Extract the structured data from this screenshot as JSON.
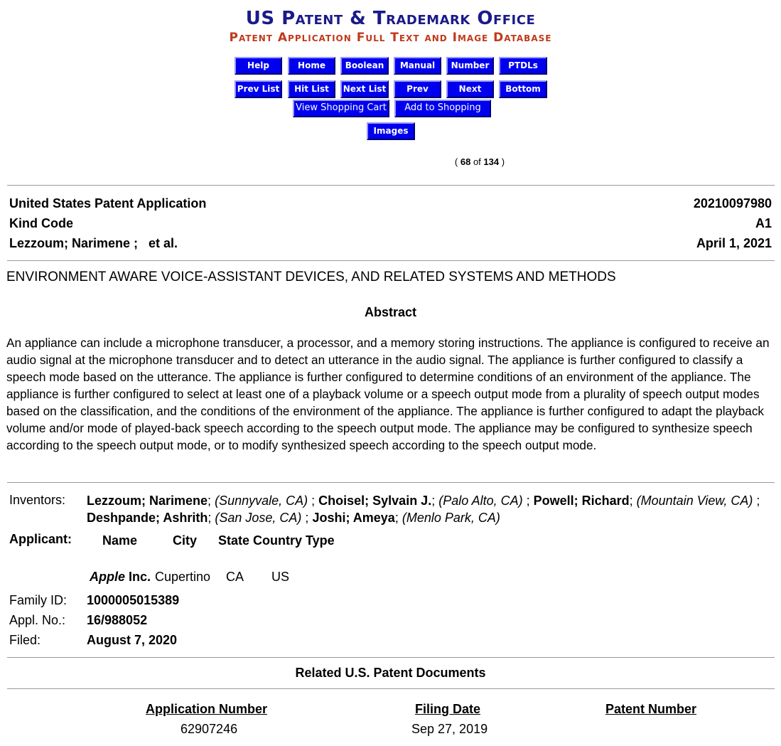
{
  "header": {
    "title": "US Patent & Trademark Office",
    "subtitle": "Patent Application Full Text and Image Database"
  },
  "nav": {
    "row1": [
      "Help",
      "Home",
      "Boolean",
      "Manual",
      "Number",
      "PTDLs"
    ],
    "row2": [
      "Prev List",
      "Hit List",
      "Next List",
      "Prev",
      "Next",
      "Bottom"
    ],
    "view_cart": "View Shopping Cart",
    "add_cart": "Add to Shopping Cart",
    "images": "Images"
  },
  "result_count": {
    "open": "(",
    "current": "68",
    "of": "of",
    "total": "134",
    "close": ")"
  },
  "doc": {
    "type_label": "United States Patent Application",
    "number": "20210097980",
    "kind_label": "Kind Code",
    "kind": "A1",
    "authors": "Lezzoum; Narimene ;   et al.",
    "date": "April 1, 2021",
    "title": "ENVIRONMENT AWARE VOICE-ASSISTANT DEVICES, AND RELATED SYSTEMS AND METHODS",
    "abstract_heading": "Abstract",
    "abstract": "An appliance can include a microphone transducer, a processor, and a memory storing instructions. The appliance is configured to receive an audio signal at the microphone transducer and to detect an utterance in the audio signal. The appliance is further configured to classify a speech mode based on the utterance. The appliance is further configured to determine conditions of an environment of the appliance. The appliance is further configured to select at least one of a playback volume or a speech output mode from a plurality of speech output modes based on the classification, and the conditions of the environment of the appliance. The appliance is further configured to adapt the playback volume and/or mode of played-back speech according to the speech output mode. The appliance may be configured to synthesize speech according to the speech output mode, or to modify synthesized speech according to the speech output mode."
  },
  "inventors": {
    "label": "Inventors:",
    "list": [
      {
        "name": "Lezzoum; Narimene",
        "loc": "(Sunnyvale, CA)"
      },
      {
        "name": "Choisel; Sylvain J.",
        "loc": "(Palo Alto, CA)"
      },
      {
        "name": "Powell; Richard",
        "loc": "(Mountain View, CA)"
      },
      {
        "name": "Deshpande; Ashrith",
        "loc": "(San Jose, CA)"
      },
      {
        "name": "Joshi; Ameya",
        "loc": "(Menlo Park, CA)"
      }
    ]
  },
  "applicant": {
    "label": "Applicant:",
    "headers": {
      "name": "Name",
      "city": "City",
      "state_country_type": "State Country Type"
    },
    "name_italic": "Apple",
    "name_rest": "Inc.",
    "city": "Cupertino",
    "state": "CA",
    "country": "US"
  },
  "family": {
    "label": "Family ID:",
    "value": "1000005015389"
  },
  "appl": {
    "label": "Appl. No.:",
    "value": "16/988052"
  },
  "filed": {
    "label": "Filed:",
    "value": "August 7, 2020"
  },
  "related": {
    "heading": "Related U.S. Patent Documents",
    "columns": [
      "Application Number",
      "Filing Date",
      "Patent Number"
    ],
    "rows": [
      [
        "62907246",
        "Sep 27, 2019",
        ""
      ]
    ]
  }
}
